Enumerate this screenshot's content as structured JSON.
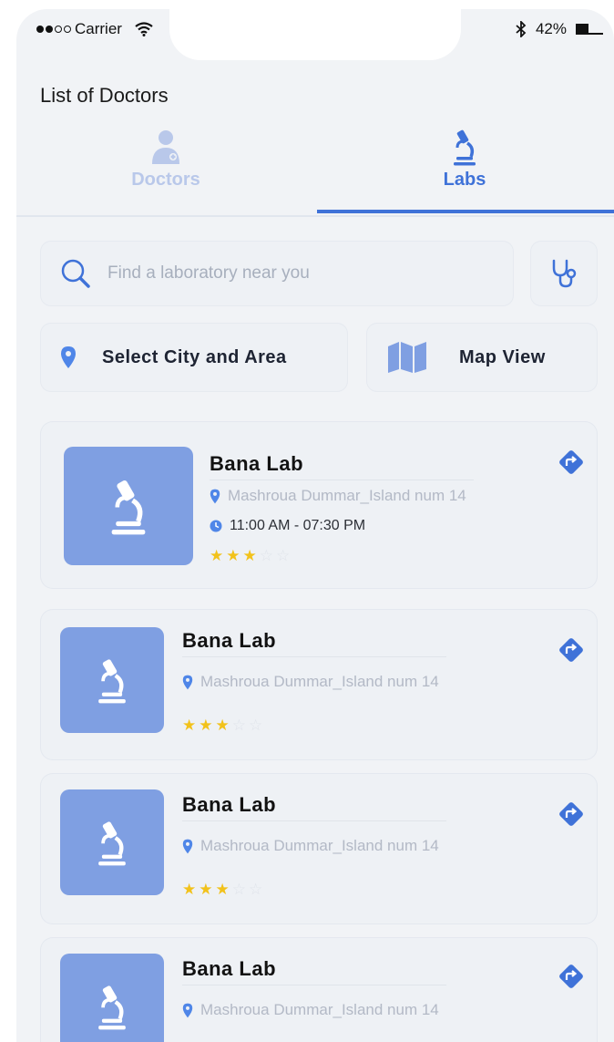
{
  "status_bar": {
    "carrier": "Carrier",
    "battery": "42%"
  },
  "page_title": "List of Doctors",
  "tabs": [
    {
      "label": "Doctors",
      "active": false
    },
    {
      "label": "Labs",
      "active": true
    }
  ],
  "search": {
    "placeholder": "Find a laboratory near you",
    "value": ""
  },
  "filters": {
    "city_label": "Select City and Area",
    "map_label": "Map View"
  },
  "labs": [
    {
      "name": "Bana Lab",
      "address": "Mashroua Dummar_Island num 14",
      "hours": "11:00 AM - 07:30 PM",
      "rating": 3,
      "max_rating": 5
    },
    {
      "name": "Bana Lab",
      "address": "Mashroua Dummar_Island num 14",
      "rating": 3,
      "max_rating": 5
    },
    {
      "name": "Bana Lab",
      "address": "Mashroua Dummar_Island num 14",
      "rating": 3,
      "max_rating": 5
    },
    {
      "name": "Bana Lab",
      "address": "Mashroua Dummar_Island num 14"
    }
  ],
  "colors": {
    "accent": "#3f72d8",
    "thumb": "#7f9fe2",
    "star": "#f2c21b",
    "background": "#f1f3f6"
  }
}
